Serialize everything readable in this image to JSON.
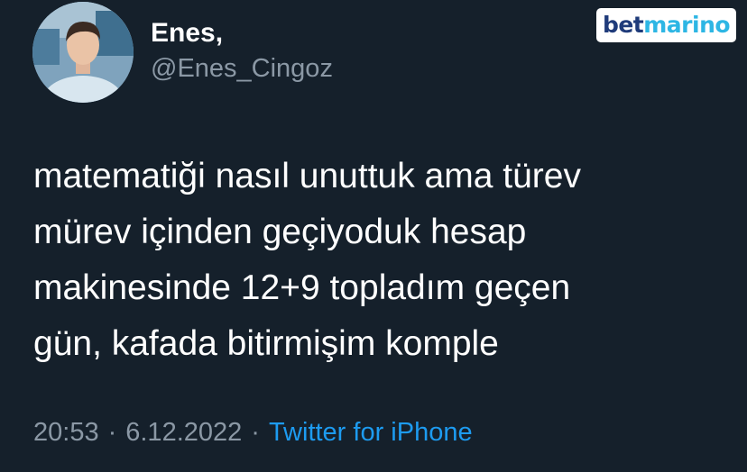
{
  "author": {
    "display_name": "Enes,",
    "handle": "@Enes_Cingoz",
    "avatar_icon": "profile-photo"
  },
  "watermark": {
    "part1": "bet",
    "part2": "marino",
    "colors": {
      "bet": "#1f3b7a",
      "marino": "#2db6e4"
    }
  },
  "tweet": {
    "lines": [
      "matematiği nasıl unuttuk ama türev",
      "mürev içinden geçiyoduk hesap",
      "makinesinde 12+9 topladım geçen",
      "gün, kafada bitirmişim komple"
    ]
  },
  "meta": {
    "time": "20:53",
    "separator": "·",
    "date": "6.12.2022",
    "source": "Twitter for iPhone"
  },
  "colors": {
    "background": "#15202b",
    "text": "#ffffff",
    "secondary_text": "#8b98a5",
    "link": "#1d9bf0"
  }
}
